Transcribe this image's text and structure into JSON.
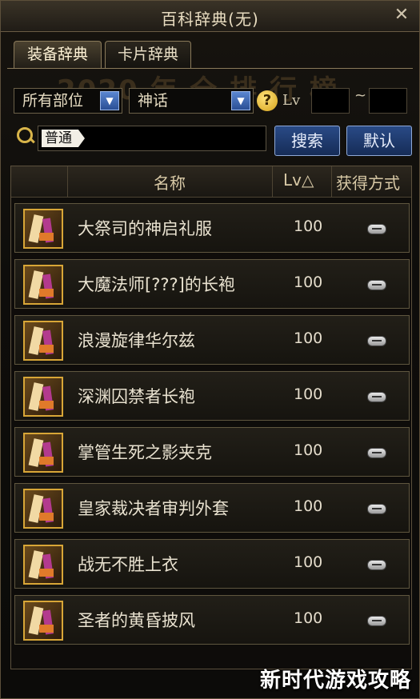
{
  "window": {
    "title": "百科辞典(无)",
    "close_symbol": "✕"
  },
  "tabs": [
    {
      "label": "装备辞典",
      "active": true
    },
    {
      "label": "卡片辞典",
      "active": false
    }
  ],
  "background_banner": "2020 年 全 排 行 榜",
  "filters": {
    "part_select": "所有部位",
    "rarity_select": "神话",
    "help_symbol": "?",
    "lv_label": "Lv",
    "lv_min": "",
    "lv_max": "",
    "tilde": "~"
  },
  "search": {
    "tag_text": "普通",
    "value": "",
    "search_button": "搜索",
    "default_button": "默认"
  },
  "table": {
    "headers": {
      "name": "名称",
      "lv": "Lv△",
      "acquire": "获得方式"
    },
    "rows": [
      {
        "name": "大祭司的神启礼服",
        "lv": "100",
        "icon": "minus-pill-icon"
      },
      {
        "name": "大魔法师[???]的长袍",
        "lv": "100",
        "icon": "minus-pill-icon"
      },
      {
        "name": "浪漫旋律华尔兹",
        "lv": "100",
        "icon": "minus-pill-icon"
      },
      {
        "name": "深渊囚禁者长袍",
        "lv": "100",
        "icon": "minus-pill-icon"
      },
      {
        "name": "掌管生死之影夹克",
        "lv": "100",
        "icon": "minus-pill-icon"
      },
      {
        "name": "皇家裁决者审判外套",
        "lv": "100",
        "icon": "minus-pill-icon"
      },
      {
        "name": "战无不胜上衣",
        "lv": "100",
        "icon": "minus-pill-icon"
      },
      {
        "name": "圣者的黄昏披风",
        "lv": "100",
        "icon": "minus-pill-icon"
      }
    ]
  },
  "watermark": "新时代游戏攻略",
  "colors": {
    "gold_border": "#d8a637",
    "button_blue": "#294a86",
    "text_cream": "#e9e2d0"
  }
}
